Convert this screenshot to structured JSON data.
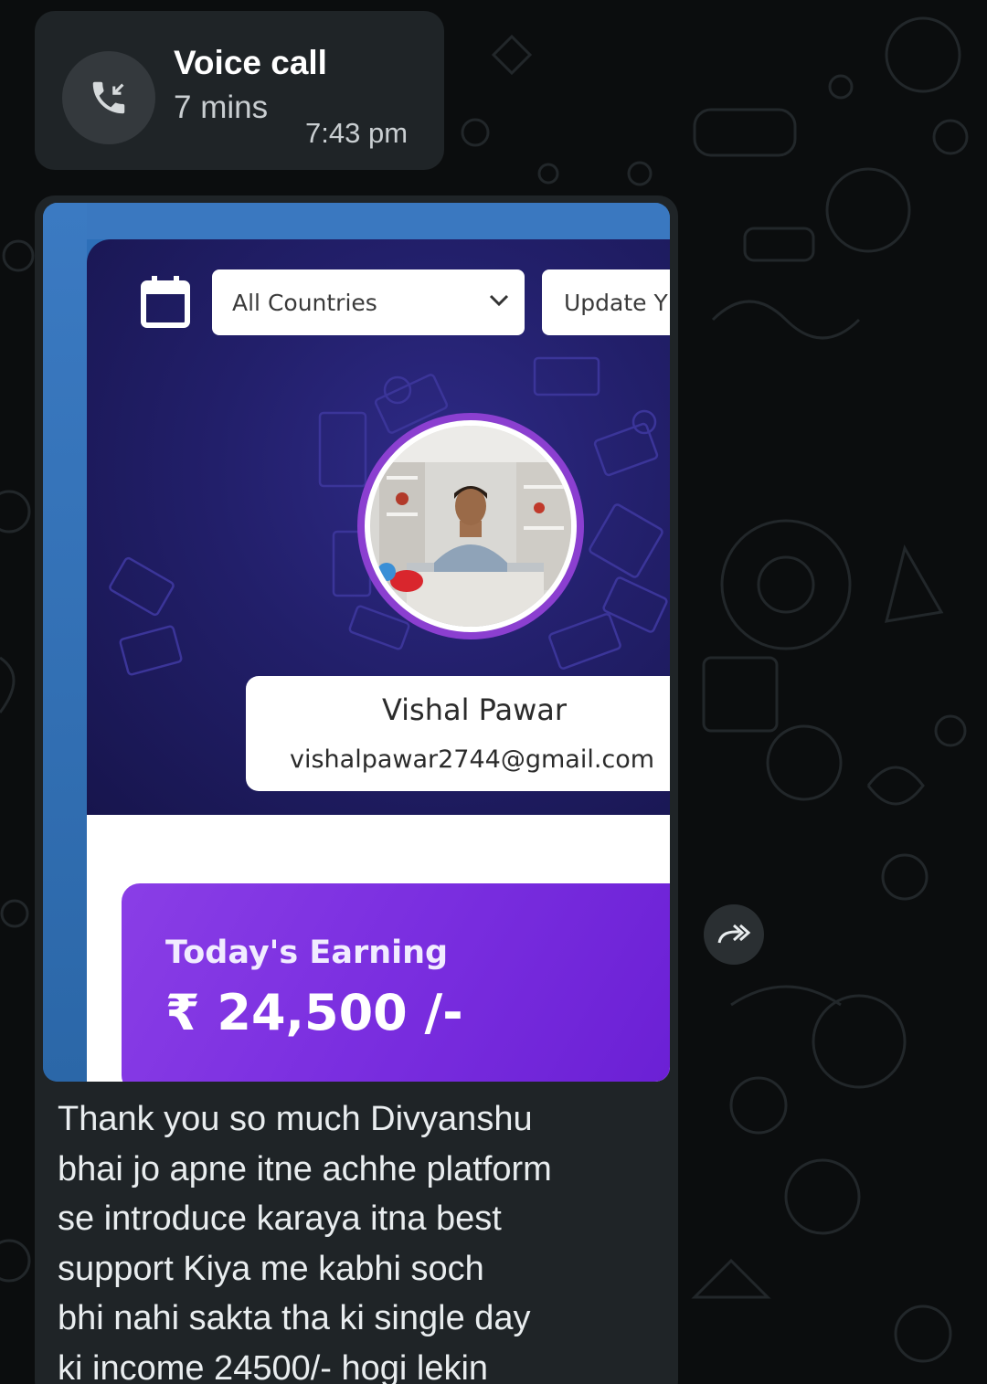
{
  "call": {
    "title": "Voice call",
    "duration": "7 mins",
    "time": "7:43 pm",
    "icon": "incoming-call-icon"
  },
  "screenshot": {
    "country_select": "All Countries",
    "update_button": "Update Y",
    "profile": {
      "name": "Vishal Pawar",
      "email": "vishalpawar2744@gmail.com"
    },
    "earning": {
      "label": "Today's Earning",
      "value": "₹ 24,500 /-"
    }
  },
  "message": {
    "lines": [
      "Thank you so much Divyanshu",
      "bhai jo apne itne achhe platform",
      "se introduce karaya itna best",
      "support Kiya me kabhi soch",
      "bhi nahi sakta tha ki single day",
      "ki income 24500/- hogi lekin"
    ]
  },
  "colors": {
    "background": "#0b0d0e",
    "bubble": "#1f2427",
    "hero": "#221f6a",
    "avatar_ring": "#8b3fd0",
    "earning_card": "#7b2fe0"
  }
}
